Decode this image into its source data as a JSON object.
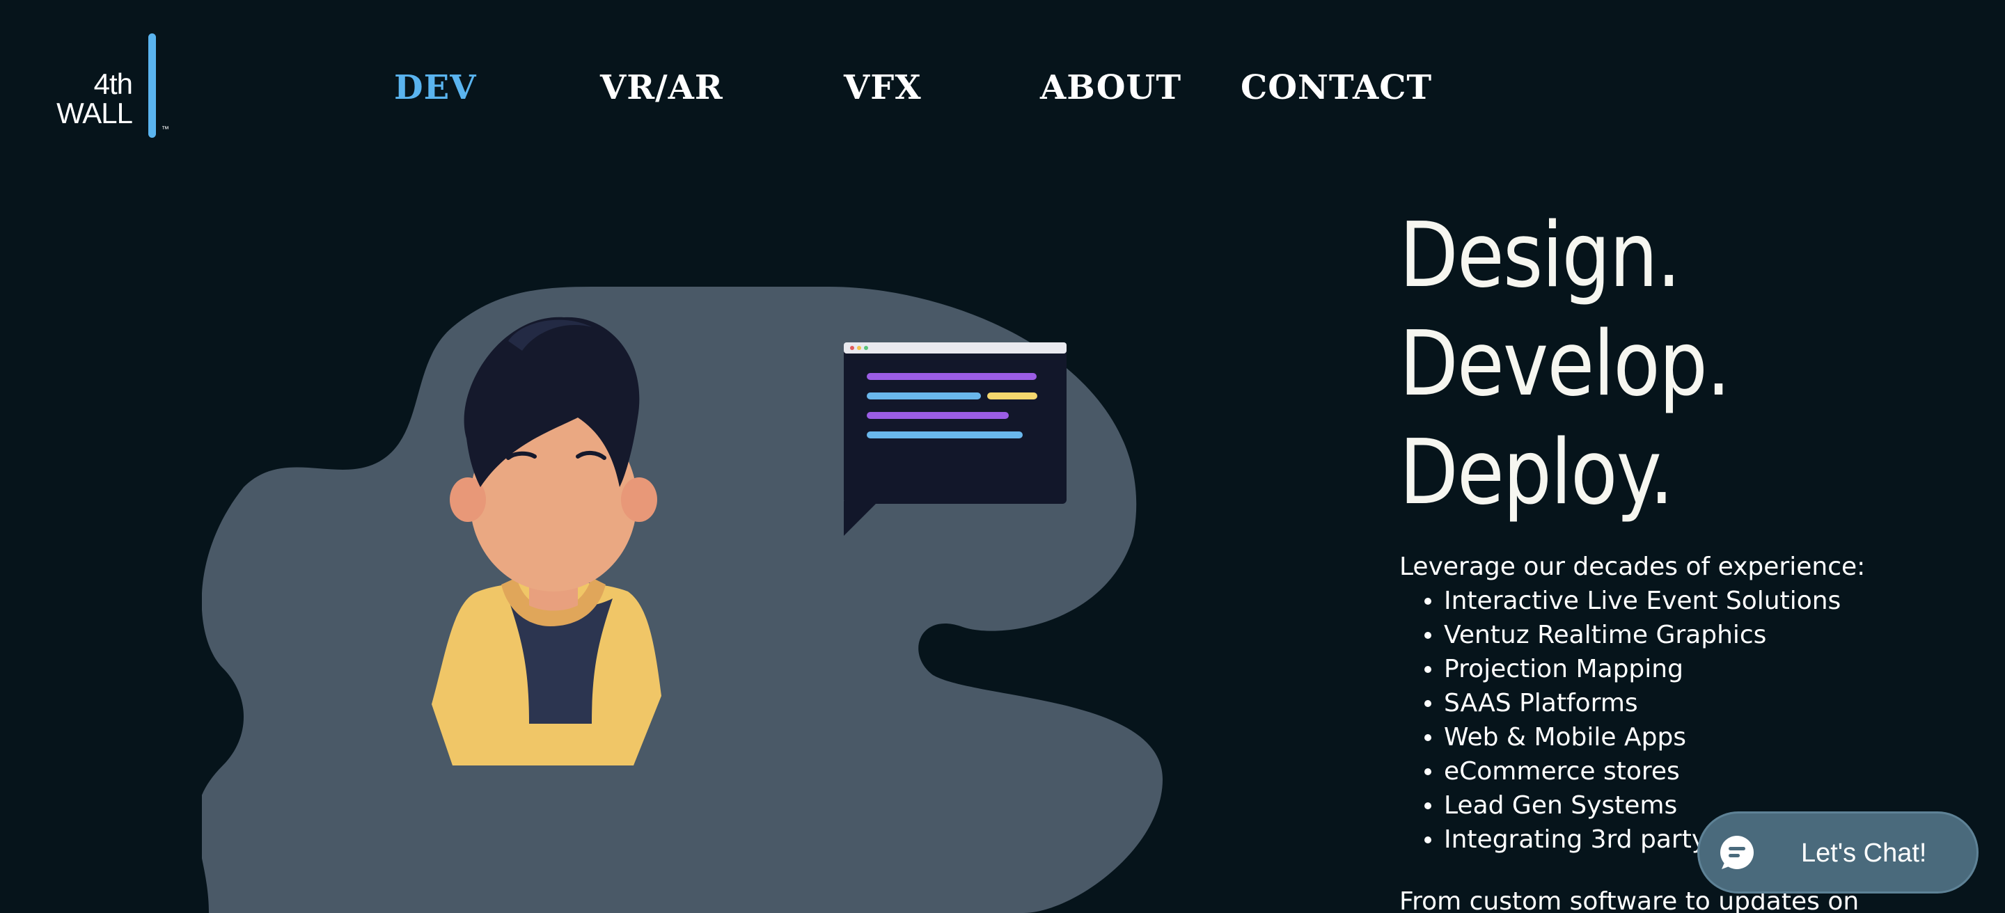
{
  "logo": {
    "line1": "4th",
    "line2": "WALL",
    "trademark": "™",
    "accent_color": "#5ab4ef"
  },
  "nav": {
    "items": [
      {
        "label": "DEV",
        "active": true
      },
      {
        "label": "VR/AR",
        "active": false
      },
      {
        "label": "VFX",
        "active": false
      },
      {
        "label": "ABOUT",
        "active": false
      },
      {
        "label": "CONTACT",
        "active": false
      }
    ],
    "active_color": "#5ab4ef"
  },
  "hero": {
    "headline": [
      "Design.",
      "Develop.",
      "Deploy."
    ],
    "intro": "Leverage our decades of experience:",
    "services": [
      "Interactive Live Event Solutions",
      "Ventuz Realtime Graphics",
      "Projection Mapping",
      "SAAS Platforms",
      "Web & Mobile Apps",
      "eCommerce stores",
      "Lead Gen Systems",
      "Integrating 3rd party to"
    ],
    "outro": "From custom software to updates on"
  },
  "illustration": {
    "description_icon": "developer-thinking-at-laptop-illustration",
    "blob_color": "#4a5a68",
    "code_line_colors": [
      "#9b5de5",
      "#6ab7ec",
      "#f5d76e"
    ]
  },
  "chat": {
    "label": "Let's Chat!",
    "icon": "chat-bubble-icon",
    "background": "#4a6a7c"
  }
}
